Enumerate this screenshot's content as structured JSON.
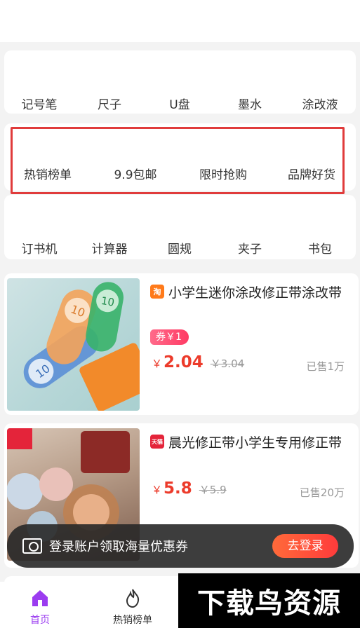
{
  "categories": {
    "row1": [
      "记号笔",
      "尺子",
      "U盘",
      "墨水",
      "涂改液"
    ],
    "row2": [
      "热销榜单",
      "9.9包邮",
      "限时抢购",
      "品牌好货"
    ],
    "row3": [
      "订书机",
      "计算器",
      "圆规",
      "夹子",
      "书包"
    ]
  },
  "products": [
    {
      "platform_icon": "taobao-icon",
      "platform_glyph": "淘",
      "title": "小学生迷你涂改修正带涂改带",
      "coupon": "券￥1",
      "currency": "￥",
      "price": "2.04",
      "old_price": "￥3.04",
      "sold": "已售1万"
    },
    {
      "platform_icon": "tmall-icon",
      "platform_glyph": "天猫",
      "title": "晨光修正带小学生专用修正带",
      "currency": "￥",
      "price": "5.8",
      "old_price": "￥5.9",
      "sold": "已售20万"
    }
  ],
  "login_banner": {
    "text": "登录账户领取海量优惠券",
    "button": "去登录"
  },
  "tabs": [
    {
      "label": "首页",
      "icon": "home-icon",
      "active": true
    },
    {
      "label": "热销榜单",
      "icon": "flame-icon",
      "active": false
    }
  ],
  "watermark": "下载鸟资源",
  "colors": {
    "accent": "#9b3cf0",
    "price": "#ec3b2b",
    "highlight_box": "#e03b3b"
  }
}
